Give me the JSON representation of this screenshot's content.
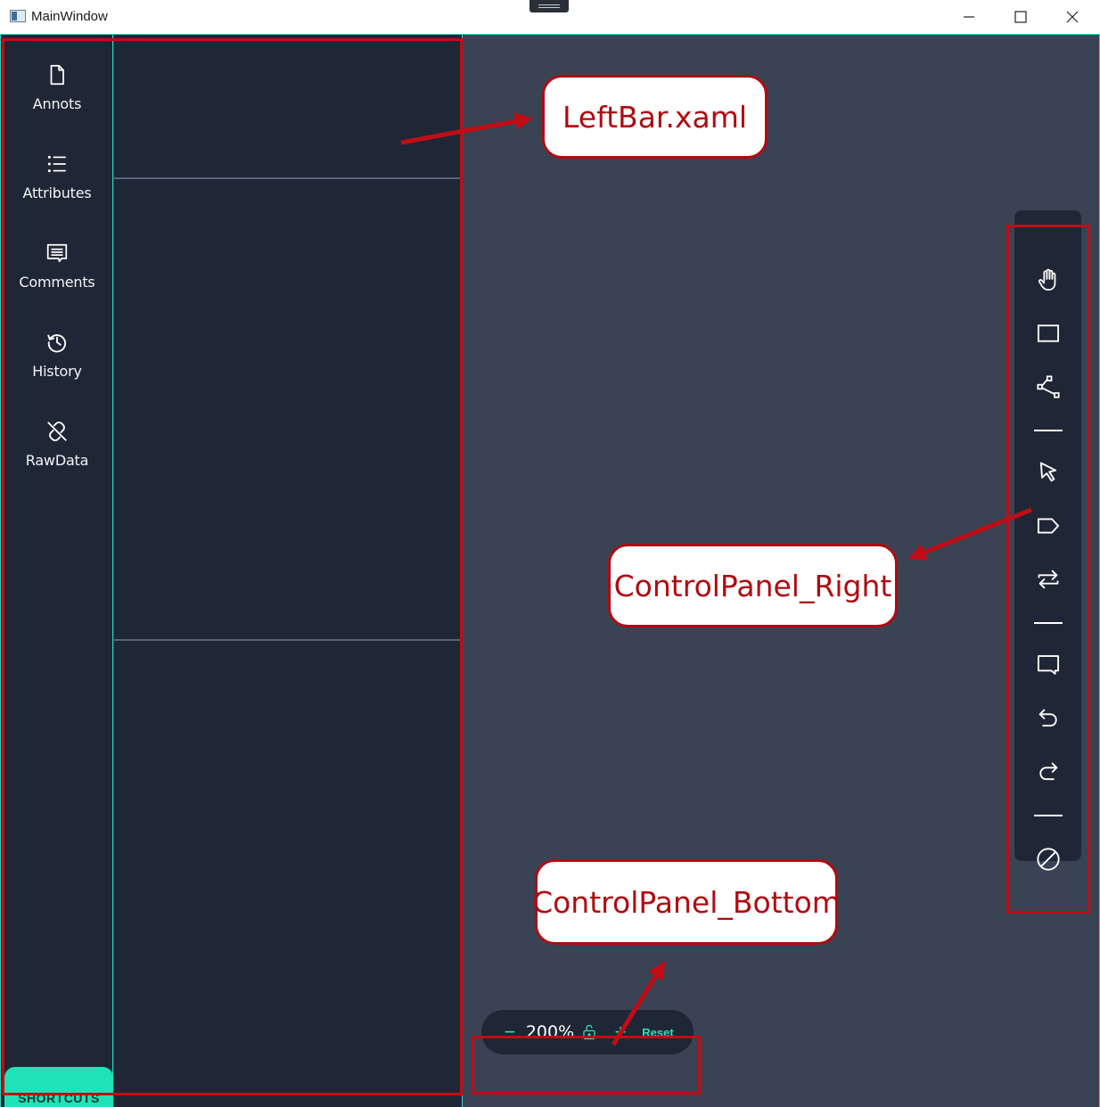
{
  "window": {
    "title": "MainWindow",
    "controls": {
      "minimize": "minimize-icon",
      "maximize": "maximize-icon",
      "close": "close-icon"
    }
  },
  "sidebar": {
    "items": [
      {
        "label": "Annots",
        "icon": "document-icon"
      },
      {
        "label": "Attributes",
        "icon": "list-icon"
      },
      {
        "label": "Comments",
        "icon": "comment-icon"
      },
      {
        "label": "History",
        "icon": "history-icon"
      },
      {
        "label": "RawData",
        "icon": "link-off-icon"
      }
    ],
    "shortcuts_label": "SHORTCUTS"
  },
  "right_panel": {
    "tools": [
      "hand-icon",
      "rectangle-icon",
      "polyline-icon",
      "pointer-icon",
      "tag-icon",
      "swap-icon",
      "comment-icon",
      "undo-icon",
      "redo-icon",
      "disable-icon"
    ]
  },
  "bottom_panel": {
    "zoom_minus": "−",
    "zoom": "200%",
    "lock_icon": "unlock-icon",
    "zoom_plus": "+",
    "reset_label": "Reset"
  },
  "annotations": {
    "leftbar": "LeftBar.xaml",
    "control_right": "ControlPanel_Right",
    "control_bottom": "ControlPanel_Bottom"
  },
  "colors": {
    "canvas": "#3a4353",
    "panel": "#1f2736",
    "accent": "#1fe3b8",
    "annotation": "#c00d16"
  }
}
